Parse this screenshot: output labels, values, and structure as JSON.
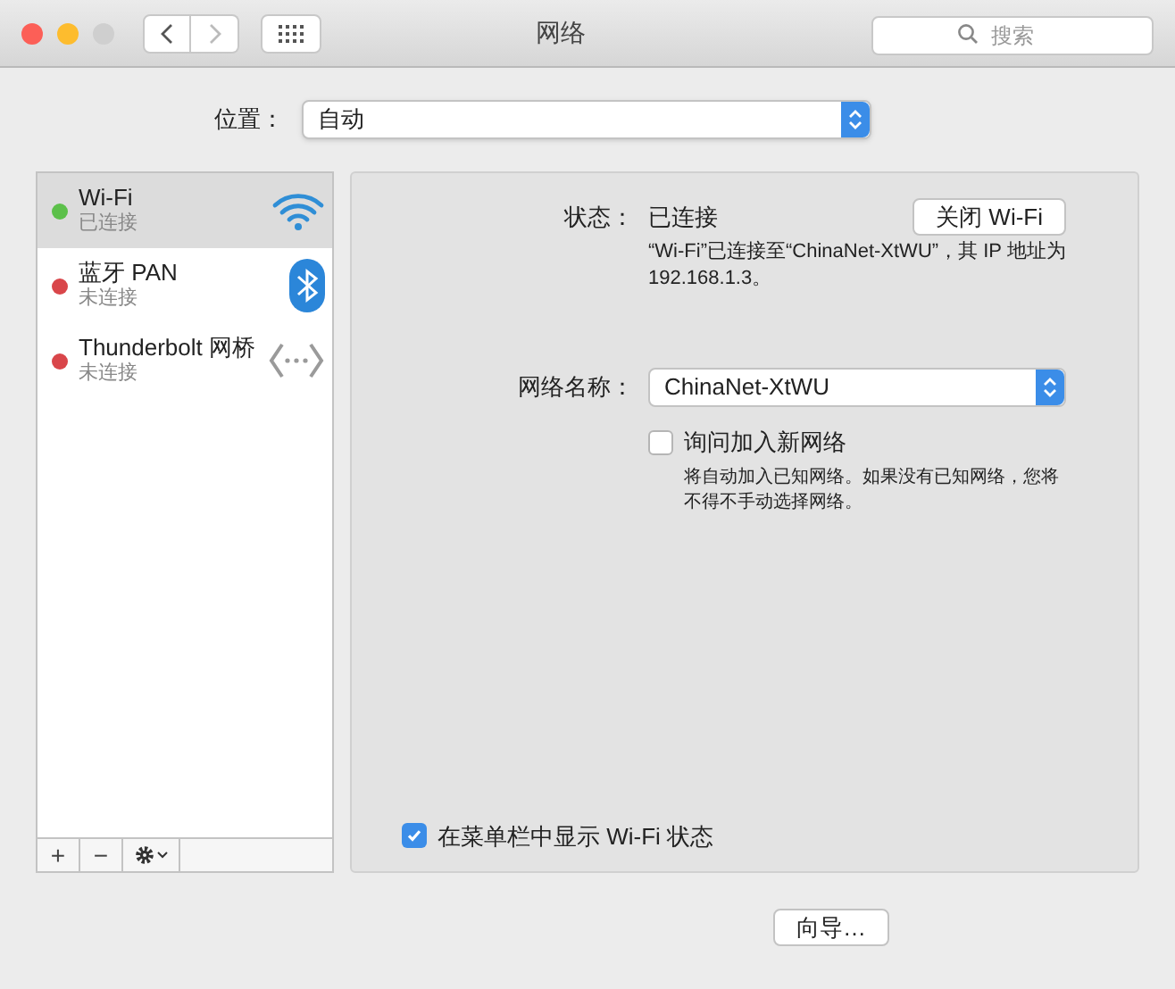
{
  "window": {
    "title": "网络"
  },
  "search": {
    "placeholder": "搜索"
  },
  "location": {
    "label": "位置：",
    "value": "自动"
  },
  "services": [
    {
      "name": "Wi-Fi",
      "status": "已连接",
      "color": "#5cc04a",
      "selected": true,
      "kind": "wifi"
    },
    {
      "name": "蓝牙 PAN",
      "status": "未连接",
      "color": "#d9464a",
      "selected": false,
      "kind": "bluetooth"
    },
    {
      "name": "Thunderbolt 网桥",
      "status": "未连接",
      "color": "#d9464a",
      "selected": false,
      "kind": "bridge"
    }
  ],
  "list_toolbar": [
    "+",
    "−"
  ],
  "detail": {
    "status_label": "状态：",
    "status_value": "已连接",
    "toggle_button": "关闭 Wi-Fi",
    "status_note": "“Wi-Fi”已连接至“ChinaNet-XtWU”，其 IP 地址为 192.168.1.3。",
    "network_label": "网络名称：",
    "network_value": "ChinaNet-XtWU",
    "ask_join": {
      "label": "询问加入新网络",
      "checked": false
    },
    "ask_note": "将自动加入已知网络。如果没有已知网络，您将不得不手动选择网络。",
    "show_in_menu": {
      "label": "在菜单栏中显示 Wi-Fi 状态",
      "checked": true
    }
  },
  "buttons": [
    "向导…"
  ]
}
